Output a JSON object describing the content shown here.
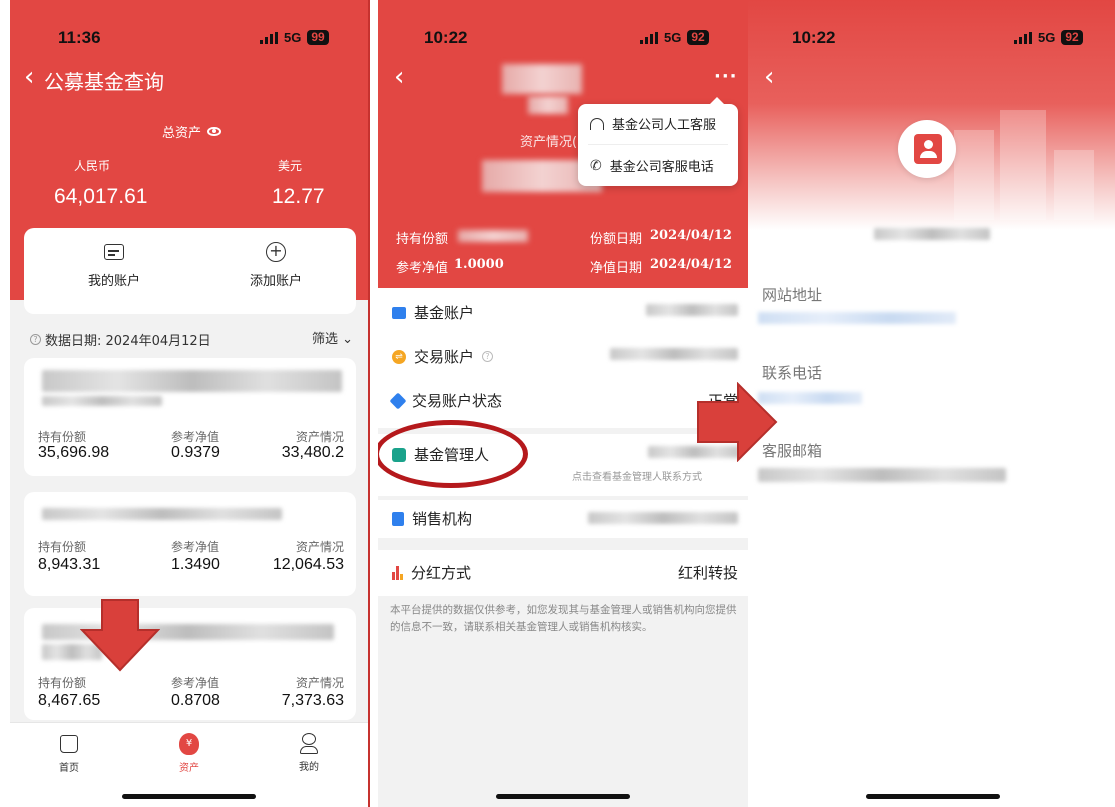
{
  "colors": {
    "brand_red": "#e24743",
    "arrow_red": "#d9403b",
    "ring_red": "#b5191c"
  },
  "phone1": {
    "status": {
      "time": "11:36",
      "network": "5G",
      "battery": "99"
    },
    "title": "公募基金查询",
    "total_assets_label": "总资产",
    "rmb_label": "人民币",
    "rmb_value": "64,017.61",
    "usd_label": "美元",
    "usd_value": "12.77",
    "my_account": "我的账户",
    "add_account": "添加账户",
    "data_date": "数据日期: 2024年04月12日",
    "filter": "筛选",
    "funds": [
      {
        "h1": "持有份额",
        "h2": "参考净值",
        "h3": "资产情况",
        "shares": "35,696.98",
        "nav": "0.9379",
        "assets": "33,480.2"
      },
      {
        "h1": "持有份额",
        "h2": "参考净值",
        "h3": "资产情况",
        "shares": "8,943.31",
        "nav": "1.3490",
        "assets": "12,064.53"
      },
      {
        "h1": "持有份额",
        "h2": "参考净值",
        "h3": "资产情况",
        "shares": "8,467.65",
        "nav": "0.8708",
        "assets": "7,373.63"
      }
    ],
    "tabs": {
      "home": "首页",
      "assets": "资产",
      "mine": "我的"
    }
  },
  "phone2": {
    "status": {
      "time": "10:22",
      "network": "5G",
      "battery": "92"
    },
    "assets_label": "资产情况(",
    "shares_label": "持有份额",
    "share_date_label": "份额日期",
    "share_date": "2024/04/12",
    "nav_label": "参考净值",
    "nav_value": "1.0000",
    "nav_date_label": "净值日期",
    "nav_date": "2024/04/12",
    "menu": {
      "service": "基金公司人工客服",
      "phone": "基金公司客服电话"
    },
    "rows": {
      "fund_account": "基金账户",
      "trade_account": "交易账户",
      "trade_status": "交易账户状态",
      "trade_status_value": "正常",
      "manager": "基金管理人",
      "manager_hint": "点击查看基金管理人联系方式",
      "sales": "销售机构",
      "dividend": "分红方式",
      "dividend_value": "红利转投"
    },
    "disclaimer": "本平台提供的数据仅供参考，如您发现其与基金管理人或销售机构向您提供的信息不一致，请联系相关基金管理人或销售机构核实。"
  },
  "phone3": {
    "status": {
      "time": "10:22",
      "network": "5G",
      "battery": "92"
    },
    "website_label": "网站地址",
    "phone_label": "联系电话",
    "email_label": "客服邮箱"
  }
}
